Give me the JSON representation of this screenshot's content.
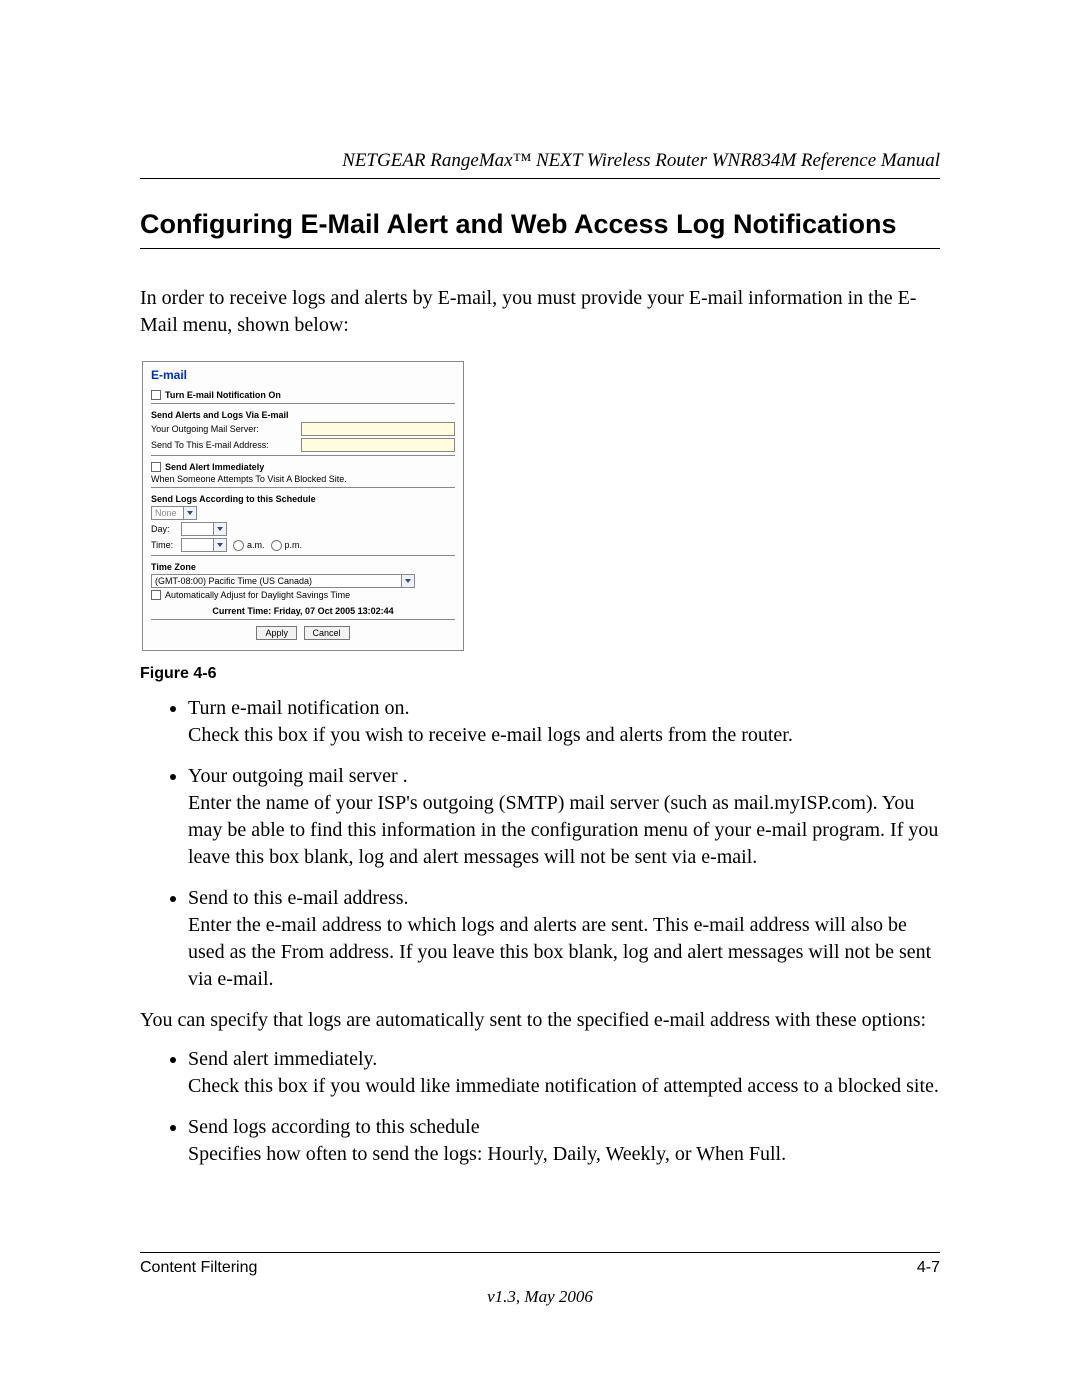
{
  "header": {
    "running": "NETGEAR RangeMax™ NEXT Wireless Router WNR834M Reference Manual"
  },
  "title": "Configuring E-Mail Alert and Web Access Log Notifications",
  "intro": "In order to receive logs and alerts by E-mail, you must provide your E-mail information in the E-Mail menu, shown below:",
  "ui": {
    "panel_title": "E-mail",
    "notif_checkbox_label": "Turn E-mail Notification On",
    "section_alerts_heading": "Send Alerts and Logs Via E-mail",
    "mail_server_label": "Your Outgoing Mail Server:",
    "email_addr_label": "Send To This E-mail Address:",
    "alert_immediate_label": "Send Alert Immediately",
    "alert_immediate_desc": "When Someone Attempts To Visit A Blocked Site.",
    "schedule_heading": "Send Logs According to this Schedule",
    "schedule_select_value": "None",
    "day_label": "Day:",
    "time_label": "Time:",
    "am_label": "a.m.",
    "pm_label": "p.m.",
    "timezone_heading": "Time Zone",
    "timezone_value": "(GMT-08:00) Pacific Time (US Canada)",
    "dst_label": "Automatically Adjust for Daylight Savings Time",
    "current_time": "Current Time:  Friday, 07 Oct 2005 13:02:44",
    "apply_btn": "Apply",
    "cancel_btn": "Cancel"
  },
  "figure_caption": "Figure 4-6",
  "bullets1": {
    "b1_head": "Turn e-mail notification on.",
    "b1_body": "Check this box if you wish to receive e-mail logs and alerts from the router.",
    "b2_head": "Your outgoing mail server .",
    "b2_body": "Enter the name of your ISP's outgoing (SMTP) mail server (such as mail.myISP.com). You may be able to find this information in the configuration menu of your e-mail program. If you leave this box blank, log and alert messages will not be sent via e-mail.",
    "b3_head": "Send to this e-mail address.",
    "b3_body": "Enter the e-mail address to which logs and alerts are sent. This e-mail address will also be used as the From address. If you leave this box blank, log and alert messages will not be sent via e-mail."
  },
  "mid_para": "You can specify that logs are automatically sent to the specified e-mail address with these options:",
  "bullets2": {
    "b1_head": "Send alert immediately.",
    "b1_body": "Check this box if you would like immediate notification of attempted access to a blocked site.",
    "b2_head": "Send logs according to this schedule",
    "b2_body": "Specifies how often to send the logs: Hourly, Daily, Weekly, or When Full."
  },
  "footer": {
    "left": "Content Filtering",
    "right": "4-7",
    "version": "v1.3, May 2006"
  }
}
